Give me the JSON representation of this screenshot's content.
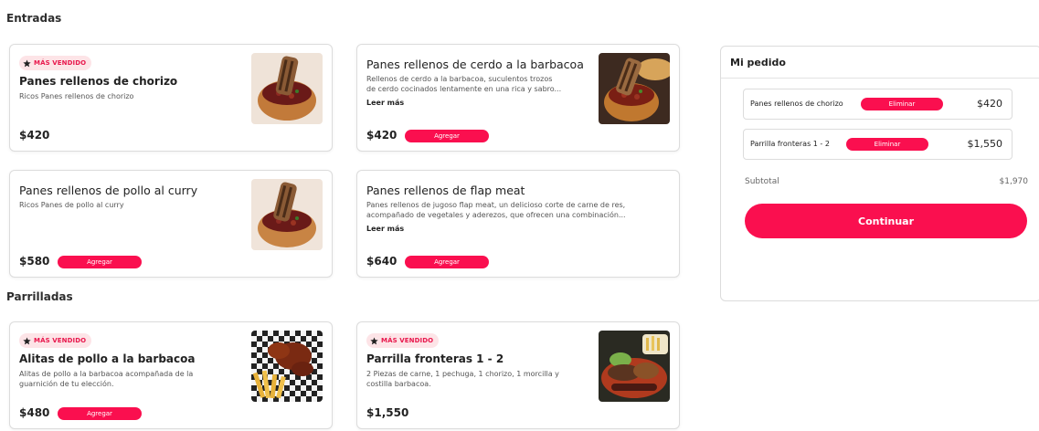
{
  "sections": {
    "entradas": "Entradas",
    "parrilladas": "Parrilladas"
  },
  "badge_label": "MÁS VENDIDO",
  "add_label": "Agregar",
  "read_more_label": "Leer más",
  "items": {
    "chorizo": {
      "name": "Panes rellenos de chorizo",
      "desc": "Ricos Panes rellenos de chorizo",
      "price": "$420"
    },
    "cerdo": {
      "name": "Panes rellenos de cerdo a la barbacoa",
      "desc1": "Rellenos de cerdo a la barbacoa, suculentos trozos",
      "desc2": "de cerdo cocinados lentamente en una rica y sabro...",
      "price": "$420"
    },
    "pollo": {
      "name": "Panes rellenos de pollo al curry",
      "desc": "Ricos Panes de pollo al curry",
      "price": "$580"
    },
    "flap": {
      "name": "Panes rellenos de flap meat",
      "desc1": "Panes rellenos de jugoso flap meat, un delicioso corte de carne de res,",
      "desc2": "acompañado de vegetales y aderezos, que ofrecen una combinación...",
      "price": "$640"
    },
    "alitas": {
      "name": "Alitas de pollo a la barbacoa",
      "desc1": "Alitas de pollo a la barbacoa acompañada de la",
      "desc2": "guarnición de tu elección.",
      "price": "$480"
    },
    "parrilla": {
      "name": "Parrilla fronteras 1 - 2",
      "desc1": "2 Piezas de carne, 1 pechuga, 1 chorizo, 1 morcilla y",
      "desc2": "costilla barbacoa.",
      "price": "$1,550"
    }
  },
  "order": {
    "title": "Mi pedido",
    "remove_label": "Eliminar",
    "lines": [
      {
        "name": "Panes rellenos de chorizo",
        "price": "$420"
      },
      {
        "name": "Parrilla fronteras 1 - 2",
        "price": "$1,550"
      }
    ],
    "subtotal_label": "Subtotal",
    "subtotal_value": "$1,970",
    "continue_label": "Continuar"
  },
  "colors": {
    "accent": "#fa0f4f",
    "badge_bg": "#fde4e7",
    "badge_text": "#e8174c"
  }
}
